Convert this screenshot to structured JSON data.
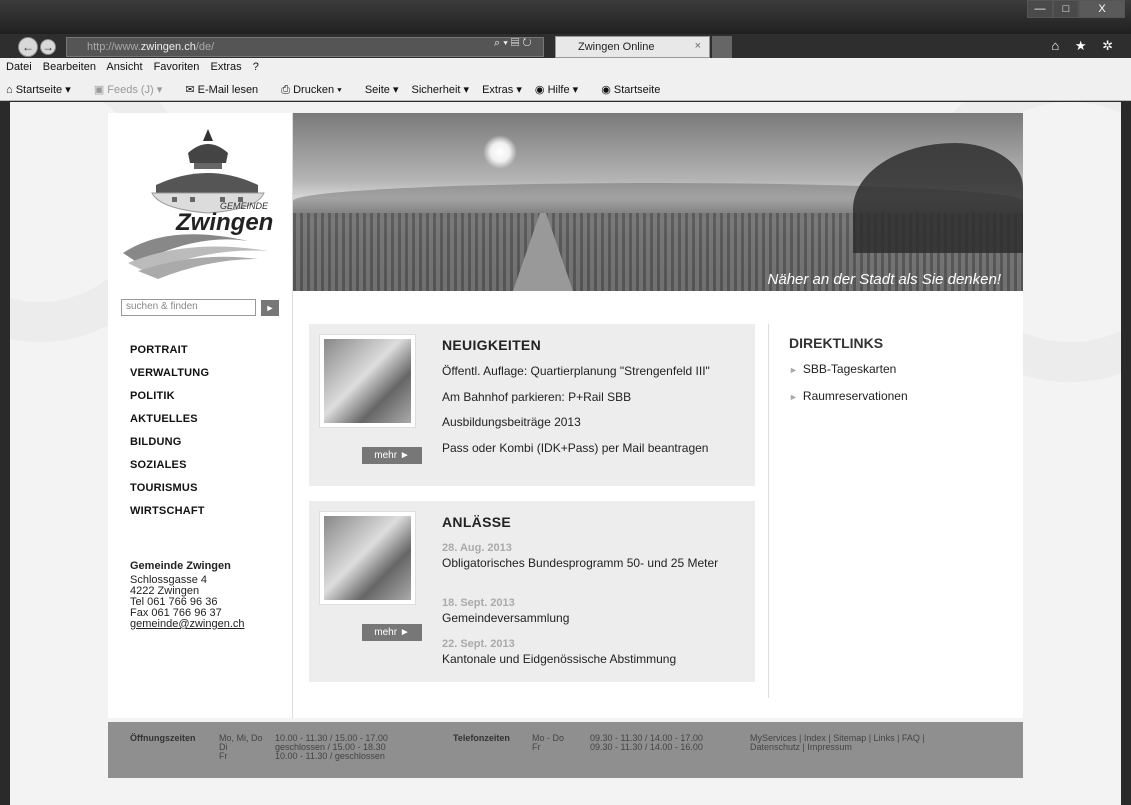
{
  "browser": {
    "url_prefix": "http://www.",
    "url_host": "zwingen.ch",
    "url_path": "/de/",
    "addr_tools": "⌕ ▾ ▤ ↻",
    "tab_title": "Zwingen Online",
    "tab_close": "×",
    "win_min": "—",
    "win_max": "□",
    "win_close": "X",
    "right_icons": "⌂ ★ ✲",
    "back": "←",
    "forward": "→",
    "menu": [
      "Datei",
      "Bearbeiten",
      "Ansicht",
      "Favoriten",
      "Extras",
      "?"
    ],
    "cmd": {
      "home": "Startseite ▾",
      "feeds": "Feeds (J) ▾",
      "email": "E-Mail lesen",
      "print": "Drucken ▾",
      "page": "Seite ▾",
      "security": "Sicherheit ▾",
      "extras": "Extras ▾",
      "help": "Hilfe ▾",
      "start2": "Startseite"
    }
  },
  "site": {
    "logo_small": "GEMEINDE",
    "logo_word": "Zwingen",
    "search_placeholder": "suchen & finden",
    "search_btn": "►",
    "nav": [
      "PORTRAIT",
      "VERWALTUNG",
      "POLITIK",
      "AKTUELLES",
      "BILDUNG",
      "SOZIALES",
      "TOURISMUS",
      "WIRTSCHAFT"
    ],
    "contact": {
      "name": "Gemeinde Zwingen",
      "street": "Schlossgasse 4",
      "city": "4222 Zwingen",
      "tel": "Tel 061 766 96 36",
      "fax": "Fax 061 766 96 37",
      "email": "gemeinde@zwingen.ch"
    },
    "tagline": "Näher an der Stadt als Sie denken!",
    "news": {
      "title": "NEUIGKEITEN",
      "items": [
        "Öffentl. Auflage: Quartierplanung \"Strengenfeld III\"",
        "Am Bahnhof parkieren: P+Rail SBB",
        "Ausbildungsbeiträge 2013",
        "Pass oder Kombi (IDK+Pass) per Mail beantragen"
      ],
      "more": "mehr ►"
    },
    "events": {
      "title": "ANLÄSSE",
      "items": [
        {
          "date": "28. Aug. 2013",
          "title": "Obligatorisches Bundesprogramm 50- und 25 Meter"
        },
        {
          "date": "18. Sept. 2013",
          "title": "Gemeindeversammlung"
        },
        {
          "date": "22. Sept. 2013",
          "title": "Kantonale und Eidgenössische Abstimmung"
        }
      ],
      "more": "mehr ►"
    },
    "direktlinks": {
      "title": "DIREKTLINKS",
      "items": [
        "SBB-Tageskarten",
        "Raumreservationen"
      ],
      "arrow": "►"
    },
    "footer": {
      "open_label": "Öffnungszeiten",
      "open_days": "Mo, Mi, Do\nDi\nFr",
      "open_times": "10.00 - 11.30 / 15.00 - 17.00\ngeschlossen / 15.00 - 18.30\n10.00 - 11.30 / geschlossen",
      "tel_label": "Telefonzeiten",
      "tel_days": "Mo - Do\nFr",
      "tel_times": "09.30 - 11.30 / 14.00 - 17.00\n09.30 - 11.30 / 14.00 - 16.00",
      "links": "MyServices | Index | Sitemap | Links | FAQ |\nDatenschutz | Impressum"
    }
  }
}
